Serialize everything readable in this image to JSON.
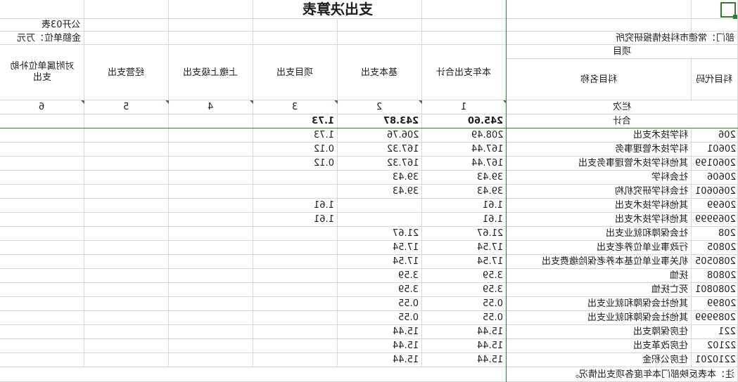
{
  "title": "支出决算表",
  "form_code": "公开03表",
  "unit_label": "金额单位：万元",
  "dept_label": "部门：常德市科技情报研究所",
  "headers": {
    "project": "项目",
    "subject_code": "科目代码",
    "subject_name": "科目名称",
    "col_total": "本年支出合计",
    "col_basic": "基本支出",
    "col_project": "项目支出",
    "col_upper": "上缴上级支出",
    "col_business": "经营支出",
    "col_subsidy": "对附属单位补助支出",
    "row_index_label": "栏次",
    "idx1": "1",
    "idx2": "2",
    "idx3": "3",
    "idx4": "4",
    "idx5": "5",
    "idx6": "6"
  },
  "totals": {
    "label": "合计",
    "total": "245.60",
    "basic": "243.87",
    "project": "1.73"
  },
  "rows": [
    {
      "code": "206",
      "name": "科学技术支出",
      "total": "208.49",
      "basic": "206.76",
      "project": "1.73"
    },
    {
      "code": "20601",
      "name": "科学技术管理事务",
      "total": "167.44",
      "basic": "167.32",
      "project": "0.12"
    },
    {
      "code": "2060199",
      "name": "其他科学技术管理事务支出",
      "total": "167.44",
      "basic": "167.32",
      "project": "0.12"
    },
    {
      "code": "20606",
      "name": "社会科学",
      "total": "39.43",
      "basic": "39.43",
      "project": ""
    },
    {
      "code": "2060601",
      "name": "社会科学研究机构",
      "total": "39.43",
      "basic": "39.43",
      "project": ""
    },
    {
      "code": "20699",
      "name": "其他科学技术支出",
      "total": "1.61",
      "basic": "",
      "project": "1.61"
    },
    {
      "code": "2069999",
      "name": "其他科学技术支出",
      "total": "1.61",
      "basic": "",
      "project": "1.61"
    },
    {
      "code": "208",
      "name": "社会保障和就业支出",
      "total": "21.67",
      "basic": "21.67",
      "project": ""
    },
    {
      "code": "20805",
      "name": "行政事业单位养老支出",
      "total": "17.54",
      "basic": "17.54",
      "project": ""
    },
    {
      "code": "2080505",
      "name": "机关事业单位基本养老保险缴费支出",
      "total": "17.54",
      "basic": "17.54",
      "project": ""
    },
    {
      "code": "20808",
      "name": "抚恤",
      "total": "3.59",
      "basic": "3.59",
      "project": ""
    },
    {
      "code": "2080801",
      "name": "死亡抚恤",
      "total": "3.59",
      "basic": "3.59",
      "project": ""
    },
    {
      "code": "20899",
      "name": "其他社会保障和就业支出",
      "total": "0.55",
      "basic": "0.55",
      "project": ""
    },
    {
      "code": "2089999",
      "name": "其他社会保障和就业支出",
      "total": "0.55",
      "basic": "0.55",
      "project": ""
    },
    {
      "code": "221",
      "name": "住房保障支出",
      "total": "15.44",
      "basic": "15.44",
      "project": ""
    },
    {
      "code": "22102",
      "name": "住房改革支出",
      "total": "15.44",
      "basic": "15.44",
      "project": ""
    },
    {
      "code": "2210201",
      "name": "住房公积金",
      "total": "15.44",
      "basic": "15.44",
      "project": ""
    }
  ],
  "note": "注：本表反映部门本年度各项支出情况。",
  "colors": {
    "grid": "#d8d8d8",
    "accent": "#2e7d32",
    "text": "#1f1f1f"
  }
}
